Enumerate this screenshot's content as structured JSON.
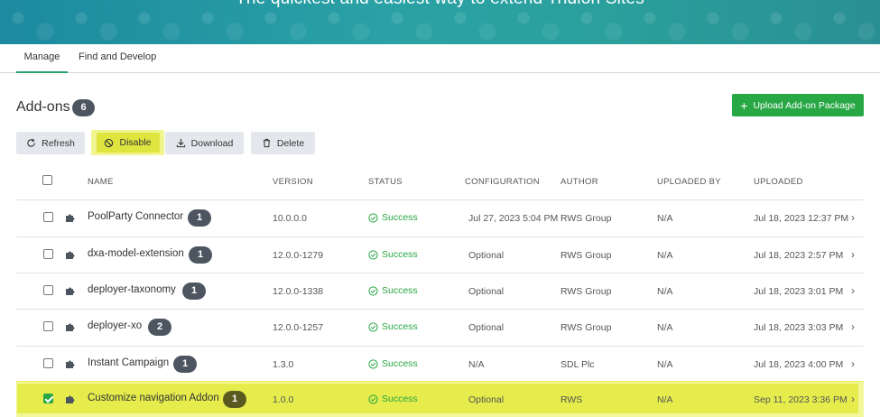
{
  "banner": {
    "title": "The quickest and easiest way to extend Tridion Sites"
  },
  "tabs": [
    {
      "label": "Manage"
    },
    {
      "label": "Find and Develop"
    }
  ],
  "page": {
    "title": "Add-ons",
    "count": "6"
  },
  "toolbar": {
    "refresh": "Refresh",
    "disable": "Disable",
    "download": "Download",
    "delete": "Delete",
    "upload": "Upload Add-on Package"
  },
  "columns": {
    "name": "NAME",
    "version": "VERSION",
    "status": "STATUS",
    "configuration": "CONFIGURATION",
    "author": "AUTHOR",
    "uploaded_by": "UPLOADED BY",
    "uploaded": "UPLOADED"
  },
  "rows": [
    {
      "name": "PoolParty Connector",
      "badge": "1",
      "version": "10.0.0.0",
      "status": "Success",
      "configuration": "Jul 27, 2023 5:04 PM",
      "author": "RWS Group",
      "uploaded_by": "N/A",
      "uploaded": "Jul 18, 2023 12:37 PM",
      "checked": false
    },
    {
      "name": "dxa-model-extension",
      "badge": "1",
      "version": "12.0.0-1279",
      "status": "Success",
      "configuration": "Optional",
      "author": "RWS Group",
      "uploaded_by": "N/A",
      "uploaded": "Jul 18, 2023 2:57 PM",
      "checked": false
    },
    {
      "name": "deployer-taxonomy",
      "badge": "1",
      "version": "12.0.0-1338",
      "status": "Success",
      "configuration": "Optional",
      "author": "RWS Group",
      "uploaded_by": "N/A",
      "uploaded": "Jul 18, 2023 3:01 PM",
      "checked": false
    },
    {
      "name": "deployer-xo",
      "badge": "2",
      "version": "12.0.0-1257",
      "status": "Success",
      "configuration": "Optional",
      "author": "RWS Group",
      "uploaded_by": "N/A",
      "uploaded": "Jul 18, 2023 3:03 PM",
      "checked": false
    },
    {
      "name": "Instant Campaign",
      "badge": "1",
      "version": "1.3.0",
      "status": "Success",
      "configuration": "N/A",
      "author": "SDL Plc",
      "uploaded_by": "N/A",
      "uploaded": "Jul 18, 2023 4:00 PM",
      "checked": false
    },
    {
      "name": "Customize navigation Addon",
      "badge": "1",
      "version": "1.0.0",
      "status": "Success",
      "configuration": "Optional",
      "author": "RWS",
      "uploaded_by": "N/A",
      "uploaded": "Sep 11, 2023 3:36 PM",
      "checked": true
    }
  ],
  "icons": {
    "row_icon": "puzzle-icon",
    "status_icon": "check-circle-icon",
    "chevron": "chevron-right-icon"
  },
  "colors": {
    "accent": "#28a745",
    "highlight": "#e5ec4c",
    "banner": "#2aa2a5"
  }
}
